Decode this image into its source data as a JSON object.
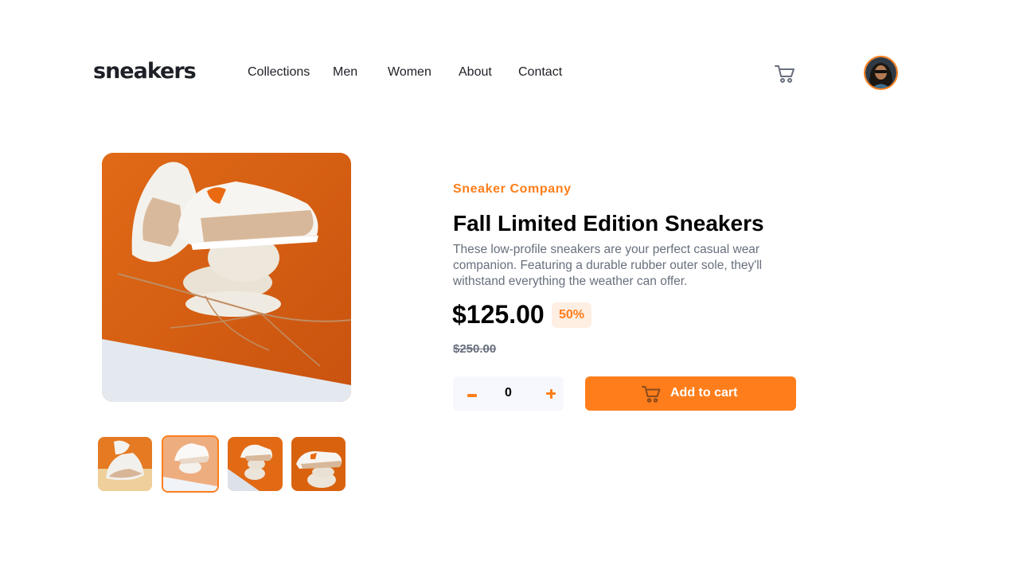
{
  "header": {
    "logo": "sneakers",
    "nav": [
      "Collections",
      "Men",
      "Women",
      "About",
      "Contact"
    ],
    "cart_icon": "cart-icon",
    "avatar_icon": "user-avatar"
  },
  "gallery": {
    "thumbnails": [
      "thumbnail-1",
      "thumbnail-2",
      "thumbnail-3",
      "thumbnail-4"
    ],
    "active_thumbnail": 2
  },
  "product": {
    "company": "Sneaker Company",
    "title": "Fall Limited Edition Sneakers",
    "description": "These low-profile sneakers are your perfect casual wear companion. Featuring a durable rubber outer sole, they'll withstand everything the weather can offer.",
    "price": "$125.00",
    "discount": "50%",
    "original_price": "$250.00"
  },
  "cart_controls": {
    "quantity": "0",
    "add_label": "Add to cart"
  },
  "colors": {
    "accent": "#ff7e1b",
    "accent_pale": "#ffeee2",
    "text_dark": "#1d2026",
    "text_muted": "#68707d"
  }
}
